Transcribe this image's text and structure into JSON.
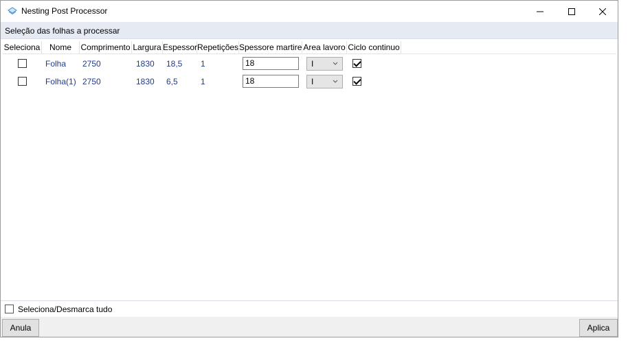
{
  "window": {
    "title": "Nesting Post Processor",
    "icons": {
      "app": "app-diamond-icon",
      "minimize": "minimize-icon",
      "maximize": "maximize-icon",
      "close": "close-icon"
    }
  },
  "section": {
    "title": "Seleção das folhas a processar"
  },
  "table": {
    "columns": [
      "Seleciona",
      "Nome",
      "Comprimento",
      "Largura",
      "Espessor",
      "Repetições",
      "Spessore martire",
      "Area lavoro",
      "Ciclo continuo"
    ],
    "rows": [
      {
        "selected": false,
        "nome": "Folha",
        "comprimento": "2750",
        "largura": "1830",
        "espessor": "18,5",
        "repeticoes": "1",
        "spessore_martire": "18",
        "area_lavoro": "I",
        "ciclo_continuo": true
      },
      {
        "selected": false,
        "nome": "Folha(1)",
        "comprimento": "2750",
        "largura": "1830",
        "espessor": "6,5",
        "repeticoes": "1",
        "spessore_martire": "18",
        "area_lavoro": "I",
        "ciclo_continuo": true
      }
    ]
  },
  "footer": {
    "select_all_label": "Seleciona/Desmarca tudo",
    "select_all_checked": false
  },
  "buttons": {
    "cancel": "Anula",
    "apply": "Aplica"
  },
  "colors": {
    "header_band": "#e6ebf3",
    "cell_text": "#1f3a8f",
    "button_bg": "#e1e1e1"
  }
}
